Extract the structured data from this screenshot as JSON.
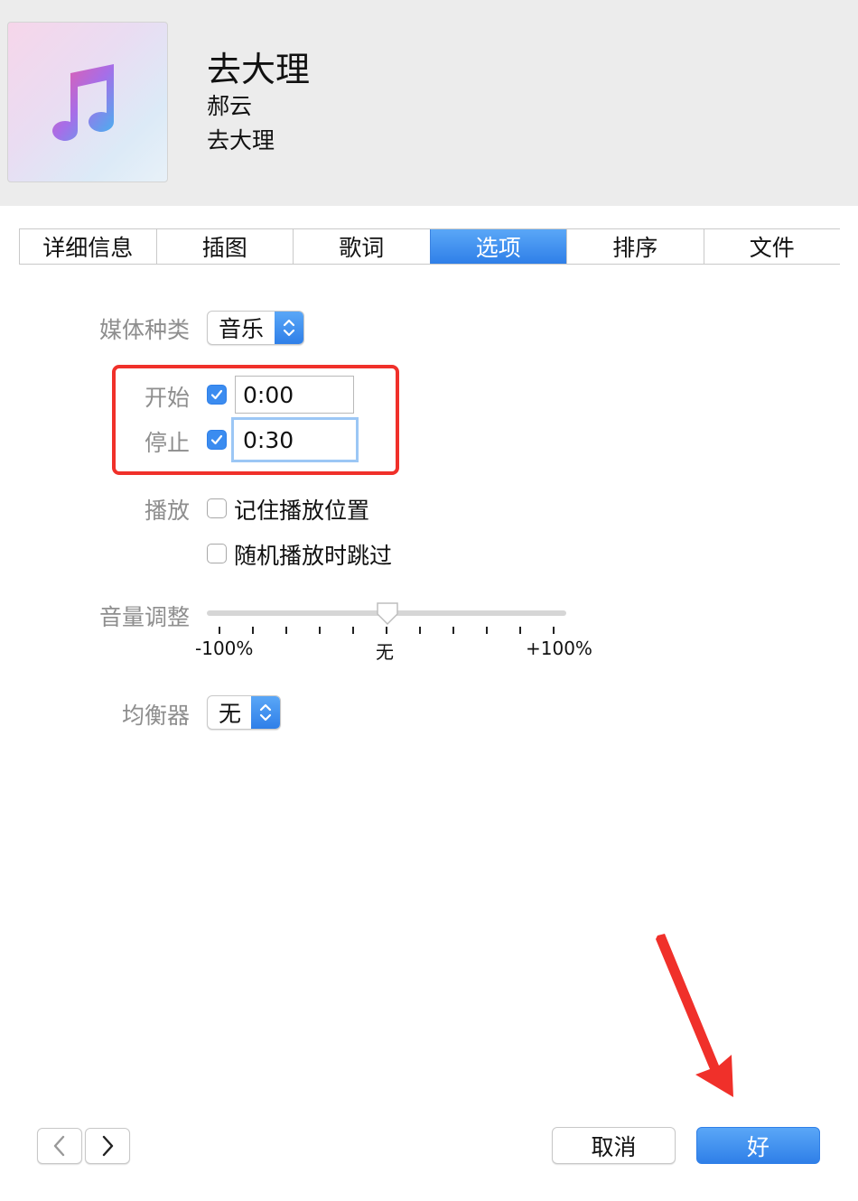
{
  "song": {
    "title": "去大理",
    "artist": "郝云",
    "album": "去大理"
  },
  "tabs": [
    {
      "label": "详细信息",
      "active": false
    },
    {
      "label": "插图",
      "active": false
    },
    {
      "label": "歌词",
      "active": false
    },
    {
      "label": "选项",
      "active": true
    },
    {
      "label": "排序",
      "active": false
    },
    {
      "label": "文件",
      "active": false
    }
  ],
  "options": {
    "media_kind": {
      "label": "媒体种类",
      "value": "音乐"
    },
    "start": {
      "label": "开始",
      "checked": true,
      "value": "0:00"
    },
    "stop": {
      "label": "停止",
      "checked": true,
      "value": "0:30"
    },
    "playback": {
      "label": "播放",
      "remember_position": {
        "label": "记住播放位置",
        "checked": false
      },
      "skip_shuffle": {
        "label": "随机播放时跳过",
        "checked": false
      }
    },
    "volume": {
      "label": "音量调整",
      "min_label": "-100%",
      "mid_label": "无",
      "max_label": "+100%",
      "value_percent": 0
    },
    "equalizer": {
      "label": "均衡器",
      "value": "无"
    }
  },
  "footer": {
    "prev_icon": "chevron-left-icon",
    "next_icon": "chevron-right-icon",
    "cancel_label": "取消",
    "ok_label": "好"
  },
  "colors": {
    "accent": "#2f7fe8",
    "highlight_annotation": "#f0302a"
  }
}
